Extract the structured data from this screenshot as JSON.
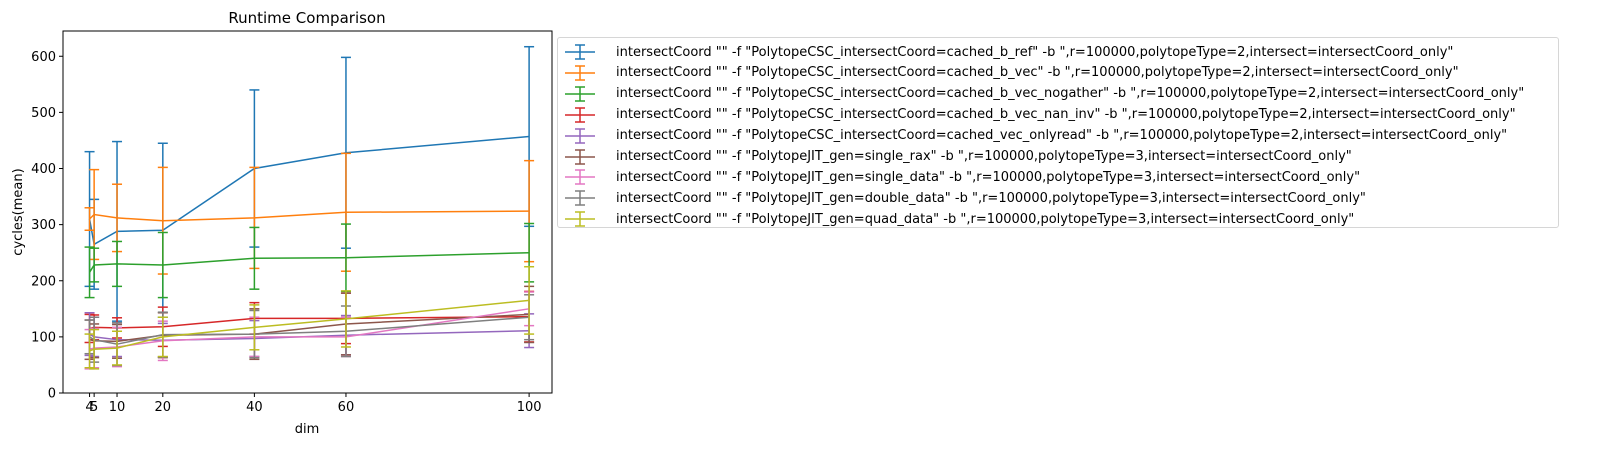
{
  "chart_data": {
    "type": "line",
    "title": "Runtime Comparison",
    "xlabel": "dim",
    "ylabel": "cycles(mean)",
    "xlim": [
      -1.8,
      105
    ],
    "ylim": [
      0,
      645
    ],
    "x_ticks": [
      4,
      5,
      10,
      20,
      40,
      60,
      100
    ],
    "y_ticks": [
      0,
      100,
      200,
      300,
      400,
      500,
      600
    ],
    "grid": false,
    "legend_placement": "outside-upper-right",
    "x": [
      4,
      5,
      10,
      20,
      40,
      60,
      100
    ],
    "series": [
      {
        "name": "intersectCoord \"\" -f \"PolytopeCSC_intersectCoord=cached_b_ref\" -b \",r=100000,polytopeType=2,intersect=intersectCoord_only\"",
        "color": "#1f77b4",
        "values": [
          310,
          265,
          288,
          290,
          400,
          428,
          457
        ],
        "err": [
          120,
          80,
          160,
          155,
          140,
          170,
          160
        ]
      },
      {
        "name": "intersectCoord \"\" -f \"PolytopeCSC_intersectCoord=cached_b_vec\" -b \",r=100000,polytopeType=2,intersect=intersectCoord_only\"",
        "color": "#ff7f0e",
        "values": [
          310,
          318,
          312,
          307,
          312,
          322,
          324
        ],
        "err": [
          20,
          80,
          60,
          95,
          90,
          105,
          90
        ]
      },
      {
        "name": "intersectCoord \"\" -f \"PolytopeCSC_intersectCoord=cached_b_vec_nogather\" -b \",r=100000,polytopeType=2,intersect=intersectCoord_only\"",
        "color": "#2ca02c",
        "values": [
          215,
          228,
          230,
          228,
          240,
          241,
          250
        ],
        "err": [
          45,
          30,
          40,
          58,
          55,
          60,
          52
        ]
      },
      {
        "name": "intersectCoord \"\" -f \"PolytopeCSC_intersectCoord=cached_b_vec_nan_inv\" -b \",r=100000,polytopeType=2,intersect=intersectCoord_only\"",
        "color": "#d62728",
        "values": [
          115,
          117,
          116,
          118,
          133,
          133,
          136
        ],
        "err": [
          25,
          22,
          18,
          35,
          28,
          45,
          45
        ]
      },
      {
        "name": "intersectCoord \"\" -f \"PolytopeCSC_intersectCoord=cached_vec_onlyread\" -b \",r=100000,polytopeType=2,intersect=intersectCoord_only\"",
        "color": "#9467bd",
        "values": [
          105,
          100,
          95,
          94,
          97,
          103,
          111
        ],
        "err": [
          38,
          35,
          30,
          30,
          32,
          35,
          30
        ]
      },
      {
        "name": "intersectCoord \"\" -f \"PolytopeJIT_gen=single_rax\" -b \",r=100000,polytopeType=3,intersect=intersectCoord_only\"",
        "color": "#8c564b",
        "values": [
          95,
          93,
          92,
          103,
          105,
          123,
          140
        ],
        "err": [
          35,
          30,
          30,
          40,
          45,
          55,
          50
        ]
      },
      {
        "name": "intersectCoord \"\" -f \"PolytopeJIT_gen=single_data\" -b \",r=100000,polytopeType=3,intersect=intersectCoord_only\"",
        "color": "#e377c2",
        "values": [
          78,
          80,
          82,
          93,
          100,
          100,
          150
        ],
        "err": [
          35,
          35,
          35,
          35,
          35,
          35,
          30
        ]
      },
      {
        "name": "intersectCoord \"\" -f \"PolytopeJIT_gen=double_data\" -b \",r=100000,polytopeType=3,intersect=intersectCoord_only\"",
        "color": "#7f7f7f",
        "values": [
          100,
          95,
          87,
          104,
          105,
          110,
          135
        ],
        "err": [
          30,
          40,
          38,
          40,
          42,
          45,
          40
        ]
      },
      {
        "name": "intersectCoord \"\" -f \"PolytopeJIT_gen=quad_data\" -b \",r=100000,polytopeType=3,intersect=intersectCoord_only\"",
        "color": "#bcbd22",
        "values": [
          75,
          78,
          80,
          100,
          117,
          132,
          165
        ],
        "err": [
          30,
          35,
          30,
          35,
          40,
          50,
          60
        ]
      }
    ]
  }
}
